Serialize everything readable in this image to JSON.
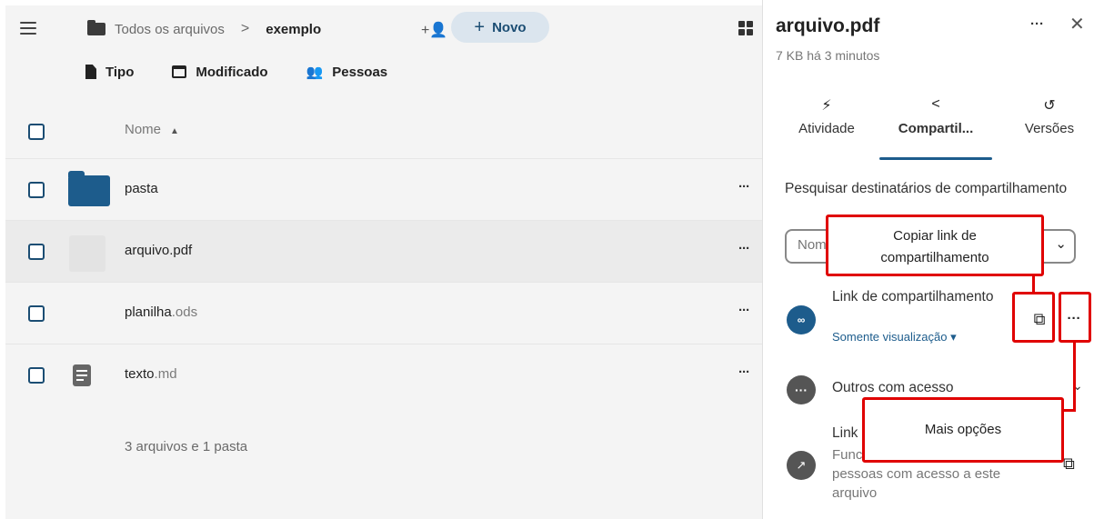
{
  "breadcrumb": {
    "root": "Todos os arquivos",
    "separator": ">",
    "current": "exemplo"
  },
  "toolbar": {
    "new_label": "Novo"
  },
  "filters": [
    {
      "label": "Tipo"
    },
    {
      "label": "Modificado"
    },
    {
      "label": "Pessoas"
    }
  ],
  "file_list": {
    "column_name": "Nome",
    "rows": [
      {
        "name": "pasta",
        "ext": "",
        "type": "folder"
      },
      {
        "name": "arquivo.pdf",
        "ext": "",
        "type": "pdf"
      },
      {
        "name": "planilha",
        "ext": ".ods",
        "type": "ods"
      },
      {
        "name": "texto",
        "ext": ".md",
        "type": "md"
      }
    ],
    "summary": "3 arquivos e 1 pasta"
  },
  "sidebar": {
    "title": "arquivo.pdf",
    "subtitle": "7 KB há 3 minutos",
    "tabs": [
      {
        "label": "Atividade",
        "icon": "lightning-icon"
      },
      {
        "label": "Compartil...",
        "icon": "share-icon"
      },
      {
        "label": "Versões",
        "icon": "history-icon"
      }
    ],
    "search_label": "Pesquisar destinatários de compartilhamento",
    "search_placeholder": "Nome, e-mail ou ID de Nuvem Federada...",
    "share_link": {
      "title": "Link de compartilhamento",
      "permission": "Somente visualização"
    },
    "others": {
      "label": "Outros com acesso"
    },
    "internal_link": {
      "title": "Link interno",
      "description": "Funciona apenas para pessoas com acesso a este arquivo"
    }
  },
  "annotations": {
    "copy_link": "Copiar link de compartilhamento",
    "more_options": "Mais opções"
  },
  "colors": {
    "accent": "#1d5c8c",
    "highlight": "#e00000",
    "new_button_bg": "#dbe5ee"
  }
}
